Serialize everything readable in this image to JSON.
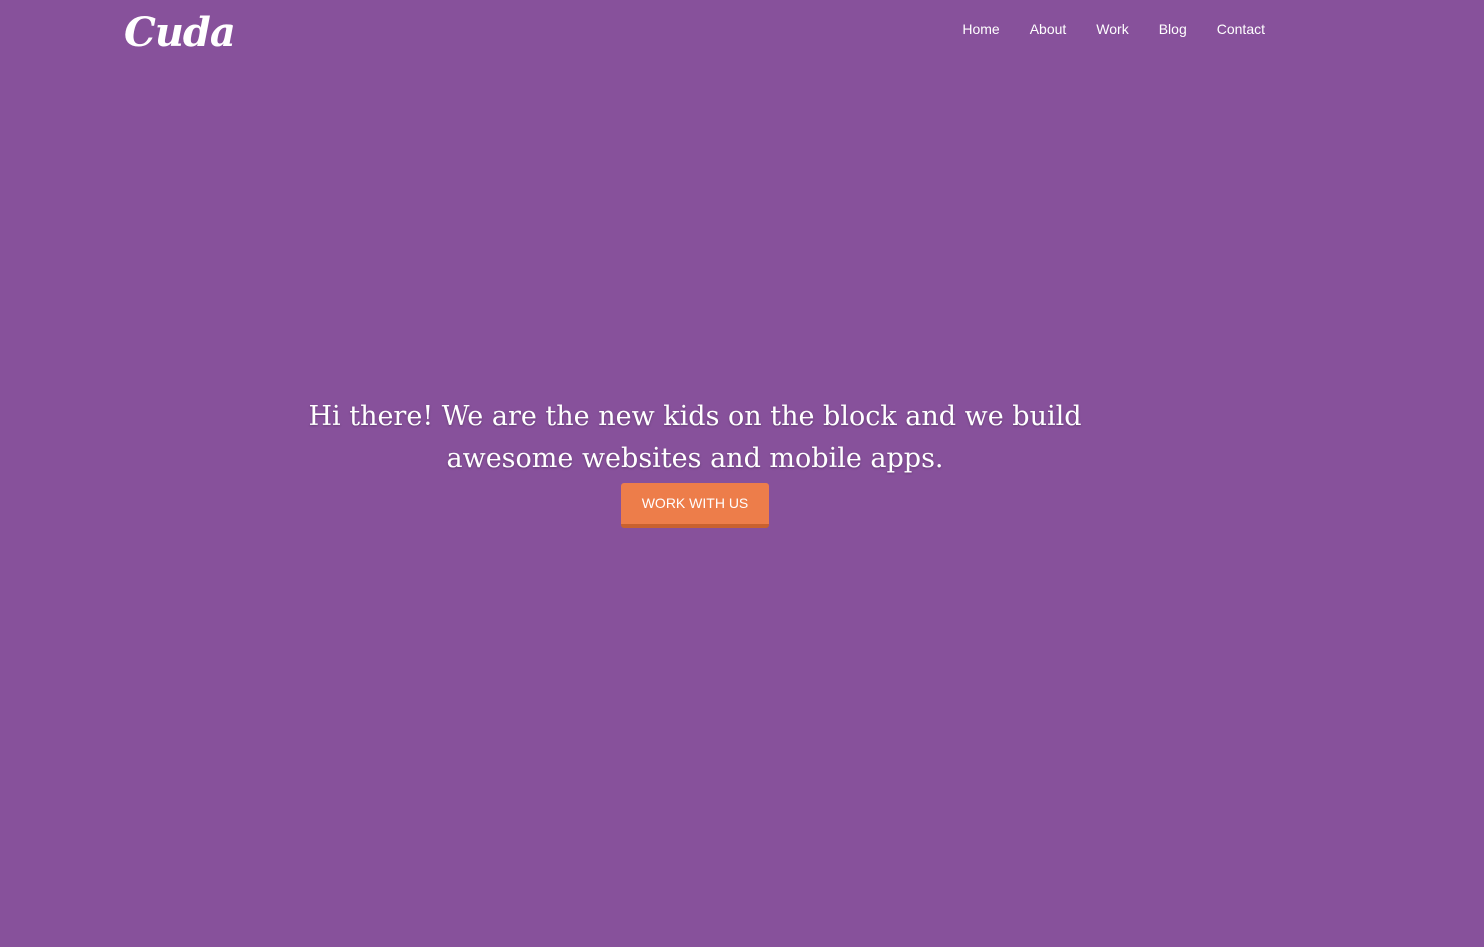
{
  "brand": {
    "name": "Cuda"
  },
  "nav": {
    "items": [
      {
        "label": "Home"
      },
      {
        "label": "About"
      },
      {
        "label": "Work"
      },
      {
        "label": "Blog"
      },
      {
        "label": "Contact"
      }
    ]
  },
  "hero": {
    "headline_line1": "Hi there! We are the new kids on the block and we build",
    "headline_line2": "awesome websites and mobile apps.",
    "cta_label": "WORK WITH US"
  },
  "colors": {
    "background": "#87519b",
    "cta": "#ed7d4a"
  }
}
